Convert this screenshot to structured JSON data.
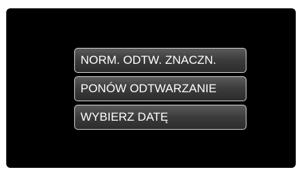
{
  "menu": {
    "items": [
      {
        "label": "NORM. ODTW. ZNACZN."
      },
      {
        "label": "PONÓW ODTWARZANIE"
      },
      {
        "label": "WYBIERZ DATĘ"
      }
    ]
  }
}
